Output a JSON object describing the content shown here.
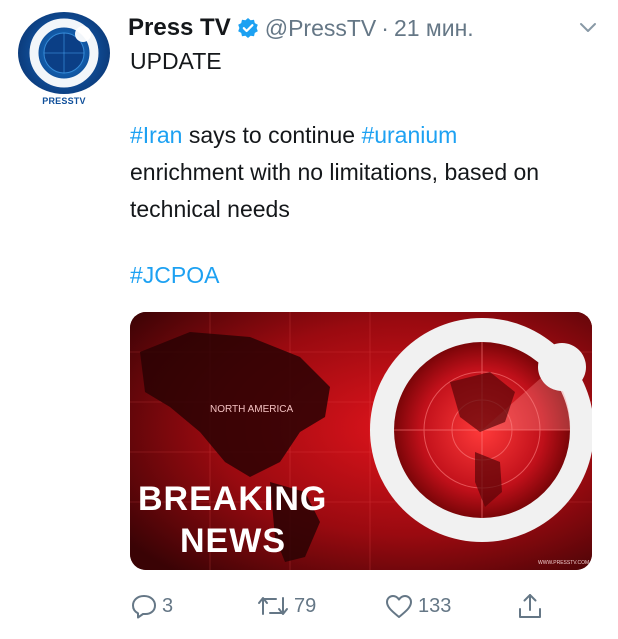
{
  "tweet": {
    "author_name": "Press TV",
    "handle": "@PressTV",
    "separator": "·",
    "time": "21 мин.",
    "avatar_caption": "PRESSTV",
    "update_label": "UPDATE",
    "body_parts": {
      "tag_iran": "#Iran",
      "text_1": " says to continue ",
      "tag_uranium": "#uranium",
      "text_2": "enrichment with no limitations, based on technical needs"
    },
    "tag_jcpoa": "#JCPOA",
    "media": {
      "map_label": "NORTH AMERICA",
      "headline_line1": "BREAKING",
      "headline_line2": "NEWS",
      "watermark": "WWW.PRESSTV.COM"
    },
    "actions": {
      "replies": "3",
      "retweets": "79",
      "likes": "133"
    }
  },
  "colors": {
    "link": "#1da1f2",
    "secondary_text": "#657786",
    "primary_text": "#14171a",
    "verified": "#1da1f2",
    "media_red": "#d0101a"
  },
  "icons": [
    "presstv-logo",
    "verified-badge-icon",
    "chevron-down-icon",
    "reply-icon",
    "retweet-icon",
    "like-icon",
    "share-icon"
  ]
}
